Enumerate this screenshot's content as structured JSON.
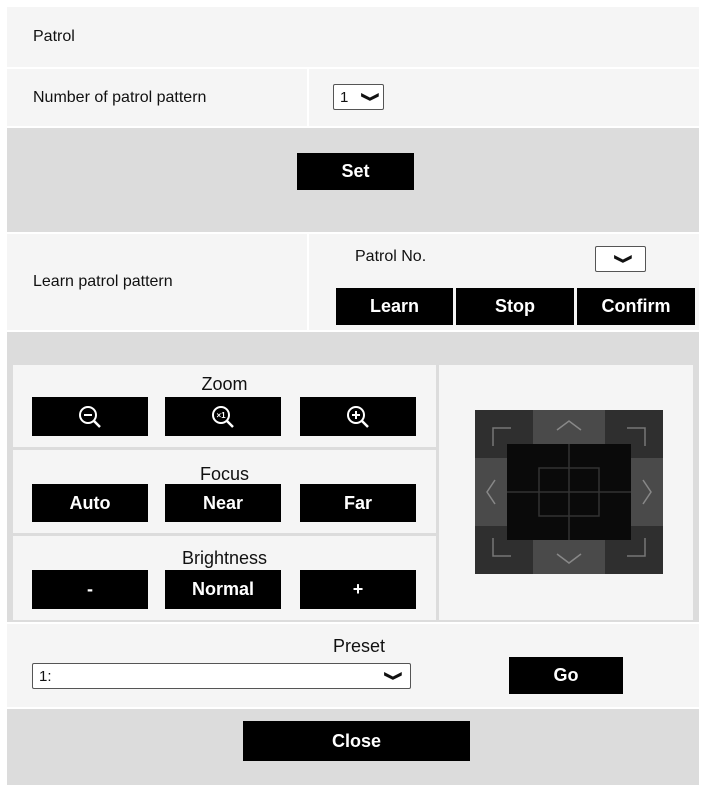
{
  "title": "Patrol",
  "patrol_count": {
    "label": "Number of patrol pattern",
    "value": "1"
  },
  "set_button": "Set",
  "learn": {
    "label": "Learn patrol pattern",
    "patrol_no_label": "Patrol No.",
    "patrol_no_value": "",
    "buttons": {
      "learn": "Learn",
      "stop": "Stop",
      "confirm": "Confirm"
    }
  },
  "zoom": {
    "title": "Zoom"
  },
  "focus": {
    "title": "Focus",
    "auto": "Auto",
    "near": "Near",
    "far": "Far"
  },
  "brightness": {
    "title": "Brightness",
    "minus": "-",
    "normal": "Normal",
    "plus": "+"
  },
  "preset": {
    "title": "Preset",
    "value": "1:",
    "go": "Go"
  },
  "close_button": "Close",
  "icons": {
    "zoom_out": "zoom-out-icon",
    "zoom_x1": "zoom-x1-icon",
    "zoom_in": "zoom-in-icon",
    "pad": "pan-tilt-pad"
  }
}
